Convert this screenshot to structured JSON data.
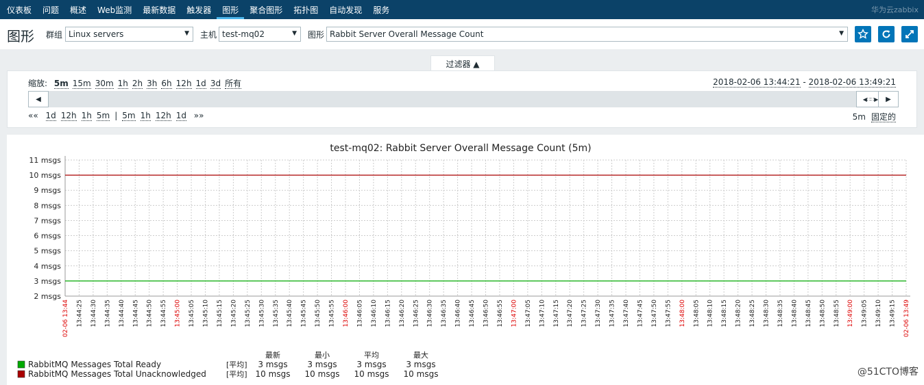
{
  "nav": {
    "items": [
      "仪表板",
      "问题",
      "概述",
      "Web监测",
      "最新数据",
      "触发器",
      "图形",
      "聚合图形",
      "拓扑图",
      "自动发现",
      "服务"
    ],
    "active_index": 6,
    "brand": "华为云zabbix"
  },
  "header": {
    "title": "图形",
    "group_label": "群组",
    "group_value": "Linux servers",
    "host_label": "主机",
    "host_value": "test-mq02",
    "graph_label": "图形",
    "graph_value": "Rabbit Server Overall Message Count",
    "icons": [
      "star-icon",
      "refresh-icon",
      "fullscreen-icon"
    ]
  },
  "filter": {
    "tab_label": "过滤器 ▲",
    "zoom_label": "缩放:",
    "zoom_options": [
      "5m",
      "15m",
      "30m",
      "1h",
      "2h",
      "3h",
      "6h",
      "12h",
      "1d",
      "3d",
      "所有"
    ],
    "zoom_active": "5m",
    "range_from": "2018-02-06 13:44:21",
    "range_sep": " - ",
    "range_to": "2018-02-06 13:49:21",
    "nav_back": [
      "«« ",
      "1d",
      "12h",
      "1h",
      "5m"
    ],
    "nav_sep": "|",
    "nav_fwd": [
      "5m",
      "1h",
      "12h",
      "1d",
      " »»"
    ],
    "period": "5m",
    "fixed_label": "固定的"
  },
  "chart_data": {
    "type": "line",
    "title": "test-mq02: Rabbit Server Overall Message Count (5m)",
    "ylim": [
      2,
      11
    ],
    "y_ticks": [
      "2 msgs",
      "3 msgs",
      "4 msgs",
      "5 msgs",
      "6 msgs",
      "7 msgs",
      "8 msgs",
      "9 msgs",
      "10 msgs",
      "11 msgs"
    ],
    "x_start_label": "02-06 13:44",
    "x_end_label": "02-06 13:49",
    "x_labels": [
      "13:44:25",
      "13:44:30",
      "13:44:35",
      "13:44:40",
      "13:44:45",
      "13:44:50",
      "13:44:55",
      "13:45:00",
      "13:45:05",
      "13:45:10",
      "13:45:15",
      "13:45:20",
      "13:45:25",
      "13:45:30",
      "13:45:35",
      "13:45:40",
      "13:45:45",
      "13:45:50",
      "13:45:55",
      "13:46:00",
      "13:46:05",
      "13:46:10",
      "13:46:15",
      "13:46:20",
      "13:46:25",
      "13:46:30",
      "13:46:35",
      "13:46:40",
      "13:46:45",
      "13:46:50",
      "13:46:55",
      "13:47:00",
      "13:47:05",
      "13:47:10",
      "13:47:15",
      "13:47:20",
      "13:47:25",
      "13:47:30",
      "13:47:35",
      "13:47:40",
      "13:47:45",
      "13:47:50",
      "13:47:55",
      "13:48:00",
      "13:48:05",
      "13:48:10",
      "13:48:15",
      "13:48:20",
      "13:48:25",
      "13:48:30",
      "13:48:35",
      "13:48:40",
      "13:48:45",
      "13:48:50",
      "13:48:55",
      "13:49:00",
      "13:49:05",
      "13:49:10",
      "13:49:15"
    ],
    "major_labels": [
      "13:45:00",
      "13:46:00",
      "13:47:00",
      "13:48:00",
      "13:49:00"
    ],
    "grid": true,
    "series": [
      {
        "name": "RabbitMQ Messages Total Ready",
        "value": 3,
        "color": "#00aa00",
        "stats": [
          "3 msgs",
          "3 msgs",
          "3 msgs",
          "3 msgs"
        ]
      },
      {
        "name": "RabbitMQ Messages Total Unacknowledged",
        "value": 10,
        "color": "#aa0000",
        "stats": [
          "10 msgs",
          "10 msgs",
          "10 msgs",
          "10 msgs"
        ]
      }
    ],
    "legend_func": "[平均]",
    "stat_headers": [
      "最新",
      "最小",
      "平均",
      "最大"
    ]
  },
  "watermark": "@51CTO博客",
  "colors": {
    "nav_bg": "#0b4268",
    "button_bg": "#0275b8",
    "major_tick": "#dd0000"
  }
}
